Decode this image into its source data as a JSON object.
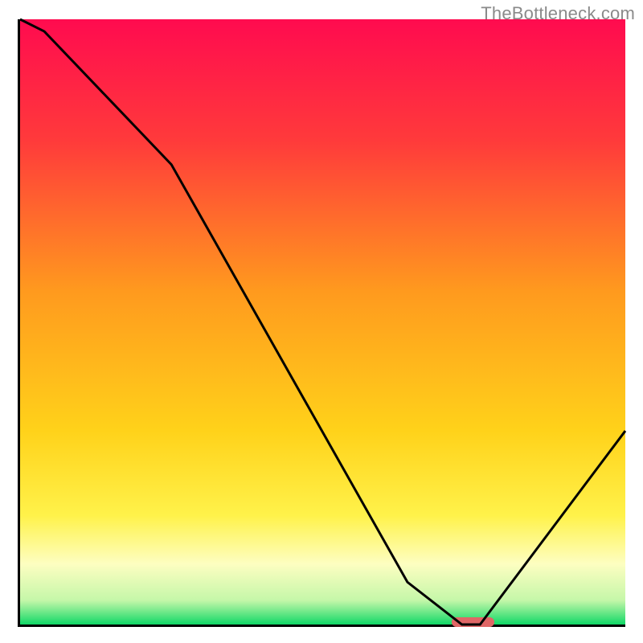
{
  "watermark": "TheBottleneck.com",
  "chart_data": {
    "type": "line",
    "title": "",
    "xlabel": "",
    "ylabel": "",
    "xlim": [
      0,
      100
    ],
    "ylim": [
      0,
      100
    ],
    "x": [
      0,
      4,
      25,
      64,
      73,
      76,
      100
    ],
    "values": [
      100,
      98,
      76,
      7,
      0,
      0,
      32
    ],
    "gradient_stops": [
      {
        "pct": 0,
        "color": "#ff0b4f"
      },
      {
        "pct": 20,
        "color": "#ff3a3b"
      },
      {
        "pct": 45,
        "color": "#ff9a1e"
      },
      {
        "pct": 68,
        "color": "#ffd21a"
      },
      {
        "pct": 82,
        "color": "#fff24a"
      },
      {
        "pct": 90,
        "color": "#fdfec1"
      },
      {
        "pct": 96,
        "color": "#c5f7a9"
      },
      {
        "pct": 100,
        "color": "#11d867"
      }
    ],
    "marker": {
      "x0": 71,
      "x1": 78,
      "y": 0
    }
  }
}
